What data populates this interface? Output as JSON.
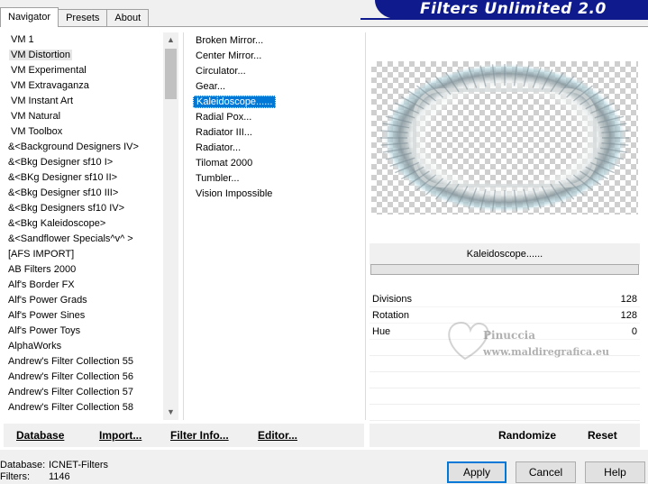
{
  "tabs": [
    "Navigator",
    "Presets",
    "About"
  ],
  "app_title": "Filters Unlimited 2.0",
  "categories": [
    "VM 1",
    "VM Distortion",
    "VM Experimental",
    "VM Extravaganza",
    "VM Instant Art",
    "VM Natural",
    "VM Toolbox",
    "&<Background Designers IV>",
    "&<Bkg Designer sf10 I>",
    "&<BKg Designer sf10 II>",
    "&<Bkg Designer sf10 III>",
    "&<Bkg Designers sf10 IV>",
    "&<Bkg Kaleidoscope>",
    "&<Sandflower Specials^v^ >",
    "[AFS IMPORT]",
    "AB Filters 2000",
    "Alf's Border FX",
    "Alf's Power Grads",
    "Alf's Power Sines",
    "Alf's Power Toys",
    "AlphaWorks",
    "Andrew's Filter Collection 55",
    "Andrew's Filter Collection 56",
    "Andrew's Filter Collection 57",
    "Andrew's Filter Collection 58"
  ],
  "selected_category": "VM Distortion",
  "filters": [
    "Broken Mirror...",
    "Center Mirror...",
    "Circulator...",
    "Gear...",
    "Kaleidoscope......",
    "Radial Pox...",
    "Radiator III...",
    "Radiator...",
    "Tilomat 2000",
    "Tumbler...",
    "Vision Impossible"
  ],
  "selected_filter": "Kaleidoscope......",
  "param_title": "Kaleidoscope......",
  "params": [
    {
      "name": "Divisions",
      "value": "128"
    },
    {
      "name": "Rotation",
      "value": "128"
    },
    {
      "name": "Hue",
      "value": "0"
    }
  ],
  "watermark": {
    "line1": "Pinuccia",
    "line2": "www.maldiregrafica.eu"
  },
  "toolbar": {
    "database": "Database",
    "import": "Import...",
    "filter_info": "Filter Info...",
    "editor": "Editor...",
    "randomize": "Randomize",
    "reset": "Reset"
  },
  "footer": {
    "database_label": "Database:",
    "database_value": "ICNET-Filters",
    "filters_label": "Filters:",
    "filters_value": "1146"
  },
  "buttons": {
    "apply": "Apply",
    "cancel": "Cancel",
    "help": "Help"
  },
  "colors": {
    "accent": "#0078d7",
    "banner": "#0f1a8c"
  },
  "icons": {
    "scroll_up": "chevron-up-icon",
    "scroll_down": "chevron-down-icon"
  }
}
